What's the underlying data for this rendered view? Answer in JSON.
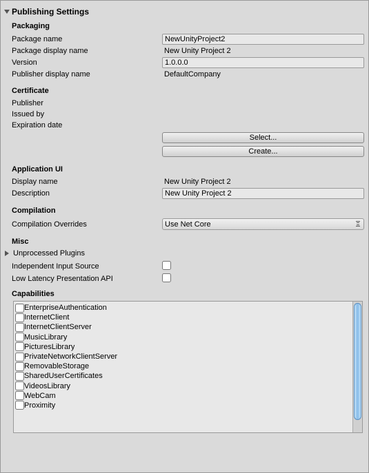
{
  "title": "Publishing Settings",
  "packaging": {
    "title": "Packaging",
    "package_name_label": "Package name",
    "package_name_value": "NewUnityProject2",
    "package_display_name_label": "Package display name",
    "package_display_name_value": "New Unity Project 2",
    "version_label": "Version",
    "version_value": "1.0.0.0",
    "publisher_display_name_label": "Publisher display name",
    "publisher_display_name_value": "DefaultCompany"
  },
  "certificate": {
    "title": "Certificate",
    "publisher_label": "Publisher",
    "issued_by_label": "Issued by",
    "expiration_label": "Expiration date",
    "select_btn": "Select...",
    "create_btn": "Create..."
  },
  "app_ui": {
    "title": "Application UI",
    "display_name_label": "Display name",
    "display_name_value": "New Unity Project 2",
    "description_label": "Description",
    "description_value": "New Unity Project 2"
  },
  "compilation": {
    "title": "Compilation",
    "overrides_label": "Compilation Overrides",
    "overrides_value": "Use Net Core"
  },
  "misc": {
    "title": "Misc",
    "unprocessed_plugins_label": "Unprocessed Plugins",
    "independent_input_label": "Independent Input Source",
    "low_latency_label": "Low Latency Presentation API"
  },
  "capabilities": {
    "title": "Capabilities",
    "items": [
      "EnterpriseAuthentication",
      "InternetClient",
      "InternetClientServer",
      "MusicLibrary",
      "PicturesLibrary",
      "PrivateNetworkClientServer",
      "RemovableStorage",
      "SharedUserCertificates",
      "VideosLibrary",
      "WebCam",
      "Proximity"
    ]
  }
}
